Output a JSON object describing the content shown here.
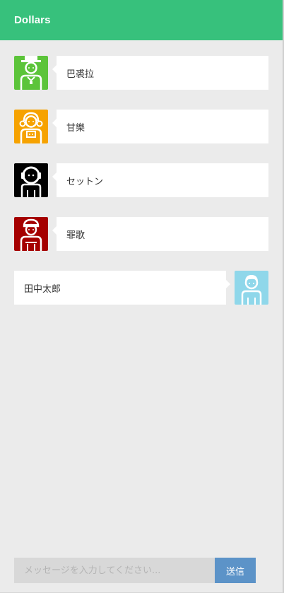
{
  "header": {
    "title": "Dollars"
  },
  "colors": {
    "header": "#37c17c",
    "background": "#ebebeb",
    "send_button": "#5c93c8"
  },
  "messages": [
    {
      "name": "巴裘拉",
      "side": "left",
      "avatar_icon": "top-hat-gentleman-icon",
      "avatar_color": "#5cc43a"
    },
    {
      "name": "甘樂",
      "side": "left",
      "avatar_icon": "pigtails-girl-icon",
      "avatar_color": "#f6a200"
    },
    {
      "name": "セットン",
      "side": "left",
      "avatar_icon": "headphones-person-icon",
      "avatar_color": "#000000"
    },
    {
      "name": "罪歌",
      "side": "left",
      "avatar_icon": "nurse-girl-icon",
      "avatar_color": "#a50000"
    },
    {
      "name": "田中太郎",
      "side": "right",
      "avatar_icon": "boy-icon",
      "avatar_color": "#8fd7ea"
    }
  ],
  "composer": {
    "placeholder": "メッセージを入力してください...",
    "value": "",
    "send_label": "送信"
  }
}
